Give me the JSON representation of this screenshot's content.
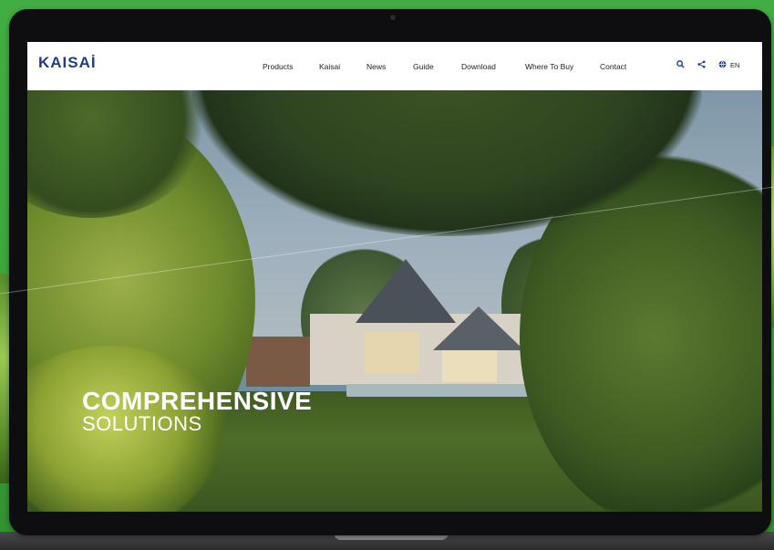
{
  "site": {
    "logo": "KAISAİ",
    "nav": [
      "Products",
      "Kaisai",
      "News",
      "Guide",
      "Download",
      "Where To Buy",
      "Contact"
    ],
    "tools": {
      "search_icon": "search-icon",
      "share_icon": "share-icon",
      "globe_icon": "globe-icon",
      "language": "EN"
    }
  },
  "hero": {
    "title": "COMPREHENSIVE",
    "subtitle": "SOLUTIONS"
  },
  "colors": {
    "brand": "#1d3f8a",
    "background_green": "#3ba53b"
  }
}
